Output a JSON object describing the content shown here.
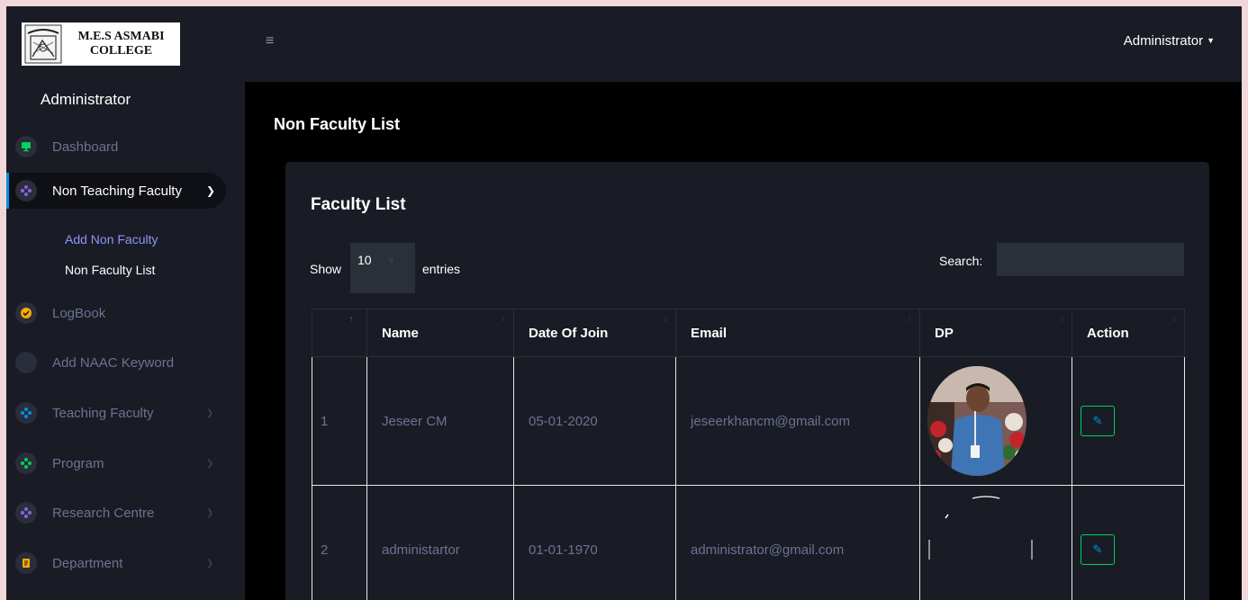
{
  "brand": {
    "logo_line1": "M.E.S ASMABI",
    "logo_line2": "COLLEGE"
  },
  "sidebar": {
    "user": "Administrator",
    "items": [
      {
        "label": "Dashboard",
        "icon": "monitor-icon",
        "color": "#00d25b"
      },
      {
        "label": "Non Teaching Faculty",
        "icon": "nodes-icon",
        "color": "#8f5fe8",
        "expanded": true
      },
      {
        "label": "LogBook",
        "icon": "check-circle-icon",
        "color": "#ffab00"
      },
      {
        "label": "Add NAAC Keyword",
        "icon": "blank-icon"
      },
      {
        "label": "Teaching Faculty",
        "icon": "nodes-icon",
        "color": "#0090e7"
      },
      {
        "label": "Program",
        "icon": "nodes-icon",
        "color": "#00d25b"
      },
      {
        "label": "Research Centre",
        "icon": "nodes-icon",
        "color": "#8f5fe8"
      },
      {
        "label": "Department",
        "icon": "document-icon",
        "color": "#ffab00"
      }
    ],
    "sub_items": [
      "Add Non Faculty",
      "Non Faculty List"
    ]
  },
  "topbar": {
    "menu_icon": "hamburger-icon",
    "user_menu": "Administrator"
  },
  "page": {
    "title": "Non Faculty List"
  },
  "card": {
    "title": "Faculty List",
    "show_label": "Show",
    "entries_value": "10",
    "entries_label": "entries",
    "search_label": "Search:"
  },
  "table": {
    "headers": [
      "",
      "Name",
      "Date Of Join",
      "Email",
      "DP",
      "Action"
    ],
    "rows": [
      {
        "no": "1",
        "name": "Jeseer CM",
        "doj": "05-01-2020",
        "email": "jeseerkhancm@gmail.com"
      },
      {
        "no": "2",
        "name": "administartor",
        "doj": "01-01-1970",
        "email": "administrator@gmail.com"
      }
    ]
  },
  "colors": {
    "accent_blue": "#0090e7",
    "accent_green": "#00d25b",
    "muted_text": "#6c7293",
    "sidebar_bg": "#191c24"
  }
}
